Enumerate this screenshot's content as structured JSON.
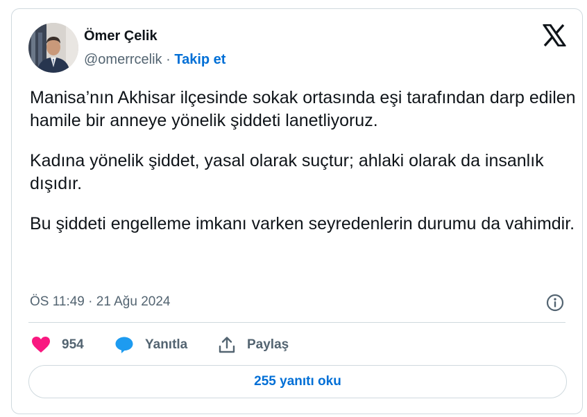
{
  "author": {
    "name": "Ömer Çelik",
    "handle": "@omerrcelik",
    "separator": "·",
    "follow_label": "Takip et"
  },
  "logo_icon": "x-logo-icon",
  "tweet": {
    "paragraphs": [
      "Manisa’nın Akhisar ilçesinde sokak ortasında eşi tarafından darp edilen hamile bir anneye yönelik şiddeti lanetliyoruz.",
      "Kadına yönelik şiddet, yasal olarak suçtur; ahlaki olarak da insanlık dışıdır.",
      "Bu şiddeti engelleme imkanı varken seyredenlerin durumu da vahimdir."
    ],
    "timestamp": "ÖS 11:49 · 21 Ağu 2024"
  },
  "actions": {
    "like_count": "954",
    "reply_label": "Yanıtla",
    "share_label": "Paylaş"
  },
  "read_replies_label": "255 yanıtı oku",
  "colors": {
    "like": "#f91880",
    "reply_bubble": "#1d9bf0",
    "link": "#006fd6",
    "muted": "#536471",
    "border": "#cfd9de"
  }
}
